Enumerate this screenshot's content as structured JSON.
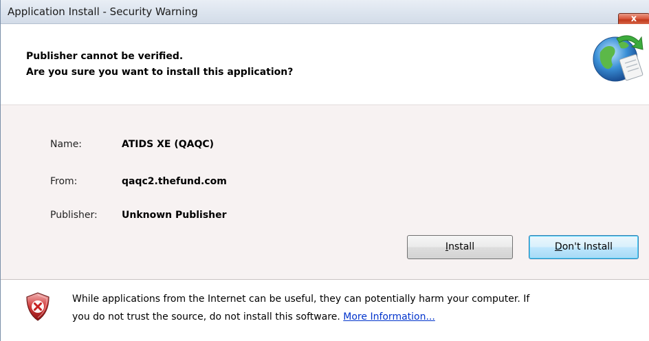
{
  "window": {
    "title": "Application Install - Security Warning",
    "close_label": "x"
  },
  "header": {
    "line1": "Publisher cannot be verified.",
    "line2": "Are you sure you want to install this application?",
    "icon": "globe-install-icon"
  },
  "details": {
    "name_label": "Name:",
    "name_value": "ATIDS XE (QAQC)",
    "from_label": "From:",
    "from_value": "qaqc2.thefund.com",
    "publisher_label": "Publisher:",
    "publisher_value": "Unknown Publisher"
  },
  "buttons": {
    "install_ul": "I",
    "install_rest": "nstall",
    "dont_ul": "D",
    "dont_rest": "on't Install"
  },
  "footer": {
    "icon": "security-shield-icon",
    "warning_line1": "While applications from the Internet can be useful, they can potentially harm your computer. If",
    "warning_line2": "you do not trust the source, do not install this software. ",
    "more_info_link": "More Information..."
  },
  "colors": {
    "link": "#0033cc",
    "body_background": "#f7f2f2",
    "close_button": "#c9452b",
    "default_button_border": "#3c7fb1"
  }
}
